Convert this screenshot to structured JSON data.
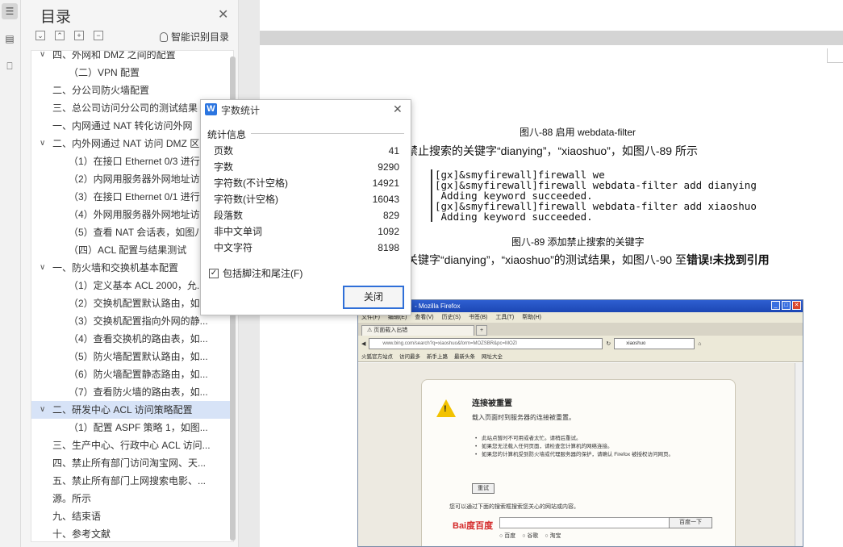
{
  "toc": {
    "title": "目录",
    "smart_label": "智能识别目录",
    "items": [
      {
        "text": "四、外网和 DMZ 之间的配置",
        "level": 1,
        "caret": "v"
      },
      {
        "text": "（二）VPN 配置",
        "level": 2,
        "caret": ""
      },
      {
        "text": "二、分公司防火墙配置",
        "level": 1,
        "caret": ""
      },
      {
        "text": "三、总公司访问分公司的测试结果",
        "level": 1,
        "caret": ""
      },
      {
        "text": "一、内网通过 NAT 转化访问外网",
        "level": 1,
        "caret": ""
      },
      {
        "text": "二、内外网通过 NAT 访问 DMZ 区",
        "level": 1,
        "caret": "v"
      },
      {
        "text": "（1）在接口 Ethernet 0/3 进行",
        "level": 2,
        "caret": ""
      },
      {
        "text": "（2）内网用服务器外网地址访",
        "level": 2,
        "caret": ""
      },
      {
        "text": "（3）在接口 Ethernet 0/1 进行",
        "level": 2,
        "caret": ""
      },
      {
        "text": "（4）外网用服务器外网地址访",
        "level": 2,
        "caret": ""
      },
      {
        "text": "（5）查看 NAT 会话表，如图八",
        "level": 2,
        "caret": ""
      },
      {
        "text": "（四）ACL 配置与结果测试",
        "level": 2,
        "caret": ""
      },
      {
        "text": "一、防火墙和交换机基本配置",
        "level": 1,
        "caret": "v"
      },
      {
        "text": "（1）定义基本 ACL 2000，允...",
        "level": 2,
        "caret": ""
      },
      {
        "text": "（2）交换机配置默认路由，如...",
        "level": 2,
        "caret": ""
      },
      {
        "text": "（3）交换机配置指向外网的静...",
        "level": 2,
        "caret": ""
      },
      {
        "text": "（4）查看交换机的路由表，如...",
        "level": 2,
        "caret": ""
      },
      {
        "text": "（5）防火墙配置默认路由，如...",
        "level": 2,
        "caret": ""
      },
      {
        "text": "（6）防火墙配置静态路由，如...",
        "level": 2,
        "caret": ""
      },
      {
        "text": "（7）查看防火墙的路由表，如...",
        "level": 2,
        "caret": ""
      },
      {
        "text": "二、研发中心 ACL 访问策略配置",
        "level": 1,
        "caret": "v",
        "selected": true
      },
      {
        "text": "（1）配置 ASPF 策略 1，如图...",
        "level": 2,
        "caret": ""
      },
      {
        "text": "三、生产中心、行政中心 ACL 访问...",
        "level": 1,
        "caret": ""
      },
      {
        "text": "四、禁止所有部门访问淘宝网、天...",
        "level": 1,
        "caret": ""
      },
      {
        "text": "五、禁止所有部门上网搜索电影、...",
        "level": 1,
        "caret": ""
      },
      {
        "text": "源。所示",
        "level": 1,
        "caret": ""
      },
      {
        "text": "九、结束语",
        "level": 1,
        "caret": ""
      },
      {
        "text": "十、参考文献",
        "level": 1,
        "caret": ""
      }
    ]
  },
  "document": {
    "caption_88": "图八-88 启用 webdata-filter",
    "line_1": "禁止搜索的关键字“dianying”，“xiaoshuo”，如图八-89 所示",
    "code_lines": [
      "[gx]&smyfirewall]firewall we",
      "[gx]&smyfirewall]firewall webdata-filter add dianying",
      " Adding keyword succeeded.",
      "[gx]&smyfirewall]firewall webdata-filter add xiaoshuo",
      " Adding keyword succeeded."
    ],
    "caption_89": "图八-89 添加禁止搜索的关键字",
    "line_2": "关键字“dianying”，“xiaoshuo”的测试结果，如图八-90 至",
    "line_2_bold": "错误!未找到引用"
  },
  "firefox": {
    "window_title": "- Mozilla Firefox",
    "menu": [
      "文件(F)",
      "编辑(E)",
      "查看(V)",
      "历史(S)",
      "书签(B)",
      "工具(T)",
      "帮助(H)"
    ],
    "tab_label": "页面载入出错",
    "url": "www.bing.com/search?q=xiaoshuo&form=MOZSBR&pc=MOZI",
    "search_text": "xiaoshuo",
    "bookmarks": [
      "火狐官方站点",
      "访问最多",
      "新手上路",
      "最新头条",
      "网址大全"
    ],
    "error_title": "连接被重置",
    "error_sub": "载入页面时到服务器的连接被重置。",
    "error_bullets": [
      "此站点暂时不可用或者太忙。请稍后重试。",
      "如果您无法载入任何页面，请检查您计算机的网络连接。",
      "如果您的计算机受到防火墙或代理服务器的保护，请确认 Firefox 被授权访问网页。"
    ],
    "retry_label": "重试",
    "hint": "您可以通过下面的搜索框搜索您关心的网站或内容。",
    "baidu_logo": "Bai度百度",
    "baidu_button": "百度一下",
    "baidu_options": [
      "百度",
      "谷歌",
      "淘宝"
    ]
  },
  "dialog": {
    "title": "字数统计",
    "section": "统计信息",
    "stats": [
      {
        "label": "页数",
        "value": "41"
      },
      {
        "label": "字数",
        "value": "9290"
      },
      {
        "label": "字符数(不计空格)",
        "value": "14921"
      },
      {
        "label": "字符数(计空格)",
        "value": "16043"
      },
      {
        "label": "段落数",
        "value": "829"
      },
      {
        "label": "非中文单词",
        "value": "1092"
      },
      {
        "label": "中文字符",
        "value": "8198"
      }
    ],
    "checkbox_label": "包括脚注和尾注(F)",
    "checkbox_checked": true,
    "close_button": "关闭"
  }
}
